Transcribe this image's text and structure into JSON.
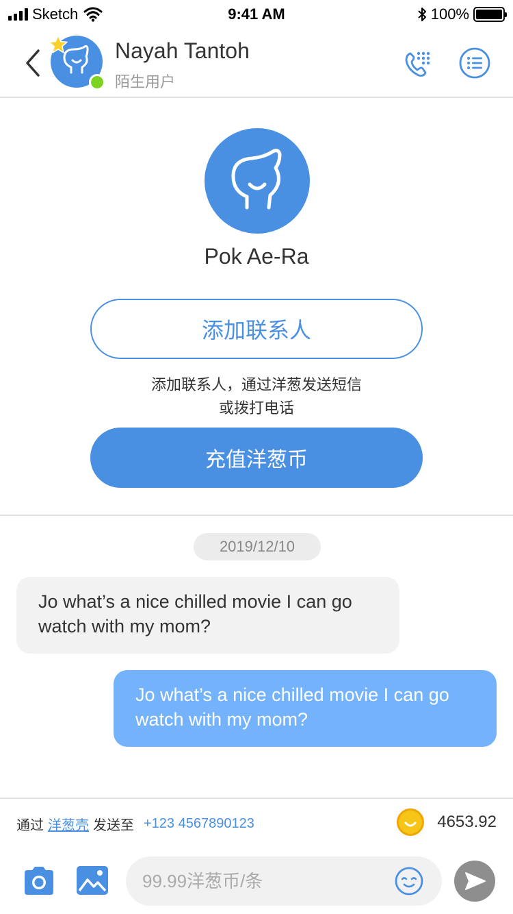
{
  "status_bar": {
    "carrier": "Sketch",
    "time": "9:41 AM",
    "battery": "100%",
    "icons": [
      "signal-icon",
      "wifi-icon",
      "bluetooth-icon",
      "battery-icon"
    ]
  },
  "header": {
    "name": "Nayah Tantoh",
    "subtitle": "陌生用户",
    "icons": [
      "back-chevron-icon",
      "star-icon",
      "phone-dialpad-icon",
      "menu-list-icon"
    ]
  },
  "profile": {
    "name": "Pok Ae-Ra",
    "add_contact_label": "添加联系人",
    "hint_line1": "添加联系人，通过洋葱发送短信",
    "hint_line2": "或拨打电话",
    "recharge_label": "充值洋葱币"
  },
  "chat": {
    "date": "2019/12/10",
    "messages": [
      {
        "direction": "incoming",
        "text": "Jo what’s a nice chilled movie I can go watch with my mom?"
      },
      {
        "direction": "outgoing",
        "text": "Jo what’s a nice chilled movie I can go watch with my mom?"
      }
    ]
  },
  "footer": {
    "via_label": "通过",
    "via_link": "洋葱壳",
    "send_to_label": "发送至",
    "phone": "+123 4567890123",
    "balance": "4653.92",
    "input_placeholder": "99.99洋葱币/条",
    "icons": [
      "camera-icon",
      "image-icon",
      "emoji-icon",
      "send-icon",
      "coin-icon"
    ]
  },
  "colors": {
    "brand_blue": "#4a90e2",
    "outgoing_bubble": "#74b3fb",
    "incoming_bubble": "#f2f2f2",
    "online_green": "#7ed321",
    "coin_gold": "#f5c518"
  }
}
